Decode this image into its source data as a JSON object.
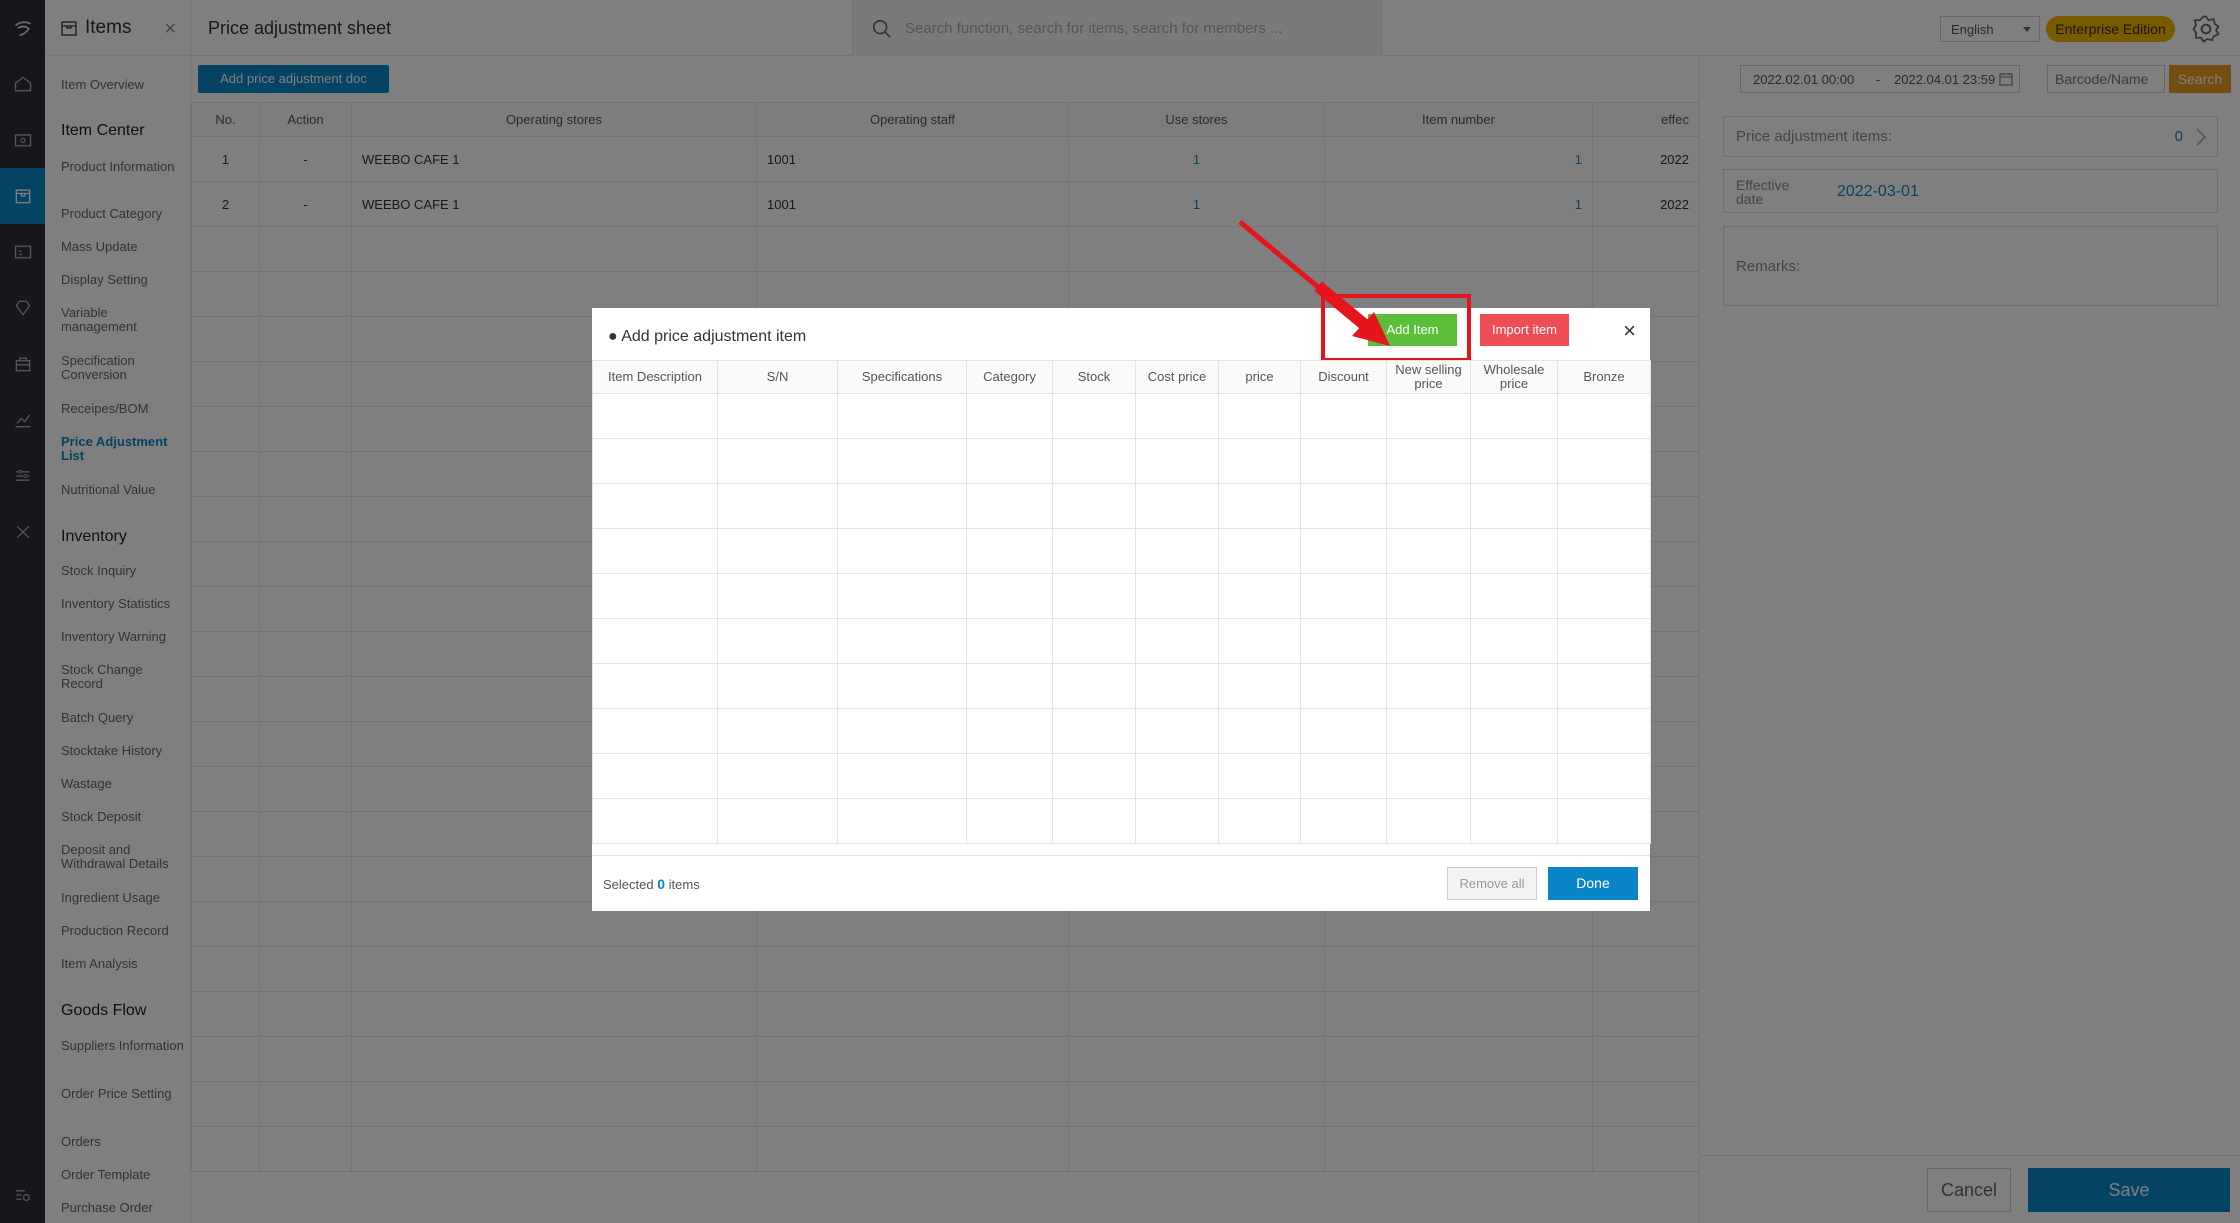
{
  "menu": {
    "title": "Items",
    "sections": [
      {
        "label": "Item Center",
        "items": [
          "Product Information",
          "Product Category",
          "Mass Update",
          "Display Setting",
          "Variable management",
          "Specification Conversion",
          "Receipes/BOM",
          "Price Adjustment List",
          "Nutritional Value"
        ]
      },
      {
        "label": "Inventory",
        "items": [
          "Stock Inquiry",
          "Inventory Statistics",
          "Inventory Warning",
          "Stock Change Record",
          "Batch Query",
          "Stocktake History",
          "Wastage",
          "Stock Deposit",
          "Deposit and Withdrawal Details",
          "Ingredient Usage",
          "Production Record",
          "Item Analysis"
        ]
      },
      {
        "label": "Goods Flow",
        "items": [
          "Suppliers Information",
          "Order Price Setting",
          "Orders",
          "Order Template",
          "Purchase Order"
        ]
      }
    ],
    "overview": "Item Overview",
    "active_item": "Price Adjustment List"
  },
  "topbar": {
    "page_title": "Price adjustment sheet",
    "search_placeholder": "Search function, search for items, search for members ...",
    "language": "English",
    "edition": "Enterprise Edition"
  },
  "main": {
    "add_button": "Add price adjustment doc",
    "columns": [
      "No.",
      "Action",
      "Operating stores",
      "Operating staff",
      "Use stores",
      "Item number",
      "effec"
    ],
    "rows": [
      {
        "no": "1",
        "action": "-",
        "store": "WEEBO CAFE 1",
        "staff": "1001",
        "use_stores": "1",
        "item_number": "1",
        "effective": "2022"
      },
      {
        "no": "2",
        "action": "-",
        "store": "WEEBO CAFE 1",
        "staff": "1001",
        "use_stores": "1",
        "item_number": "1",
        "effective": "2022"
      }
    ]
  },
  "right_panel": {
    "date_start": "2022.02.01 00:00",
    "date_sep": "-",
    "date_end": "2022.04.01 23:59",
    "barcode_placeholder": "Barcode/Name",
    "search_label": "Search",
    "items_label": "Price adjustment items:",
    "items_count": "0",
    "effective_label": "Effective date",
    "effective_value": "2022-03-01",
    "remarks_label": "Remarks:",
    "cancel_label": "Cancel",
    "save_label": "Save"
  },
  "modal": {
    "title": "● Add price adjustment item",
    "add_item": "Add Item",
    "import_item": "Import item",
    "close": "×",
    "columns": [
      "Item Description",
      "S/N",
      "Specifications",
      "Category",
      "Stock",
      "Cost price",
      "price",
      "Discount",
      "New selling price",
      "Wholesale price",
      "Bronze"
    ],
    "selected_prefix": "Selected",
    "selected_count": "0",
    "selected_suffix": "items",
    "remove_all": "Remove all",
    "done": "Done"
  },
  "colors": {
    "accent": "#0a86c8",
    "add_green": "#5bbf3a",
    "import_red": "#ef4d55",
    "edition_gold": "#f0b400",
    "search_orange": "#e79a1f",
    "highlight_red": "#e8141b"
  }
}
